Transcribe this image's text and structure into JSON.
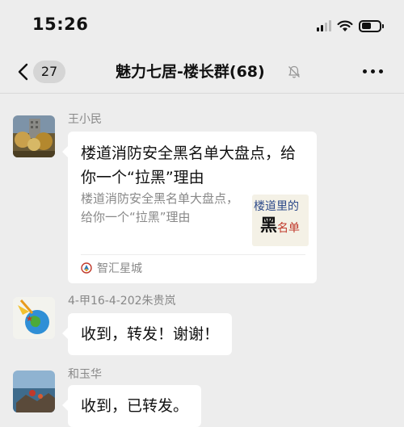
{
  "status_bar": {
    "time": "15:26",
    "battery_level": 0.55
  },
  "header": {
    "back_count": "27",
    "title": "魅力七居-楼长群(68)",
    "muted": true
  },
  "messages": [
    {
      "sender": "王小民",
      "type": "link_card",
      "card": {
        "title": "楼道消防安全黑名单大盘点，给你一个“拉黑”理由",
        "description": "楼道消防安全黑名单大盘点，给你一个“拉黑”理由",
        "thumbnail_text": [
          "楼道里的",
          "黑",
          "名单"
        ],
        "source": "智汇星城"
      }
    },
    {
      "sender": "4-甲16-4-202朱贵岚",
      "type": "text",
      "text": "收到，转发！谢谢！"
    },
    {
      "sender": "和玉华",
      "type": "text",
      "text": "收到，已转发。"
    }
  ],
  "colors": {
    "background": "#ededed",
    "bubble": "#ffffff",
    "sender_name": "#888888"
  }
}
